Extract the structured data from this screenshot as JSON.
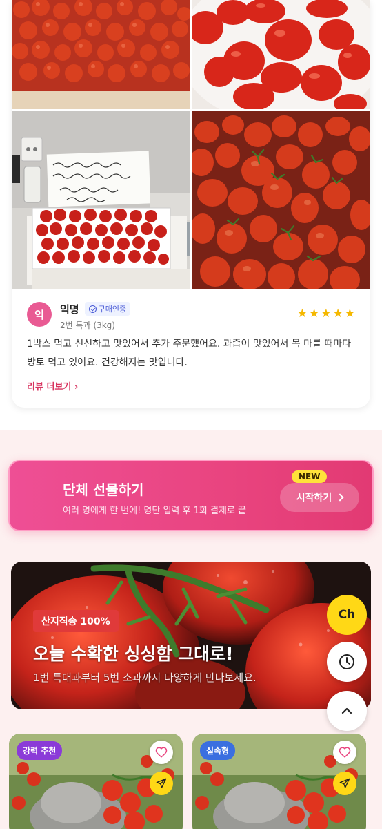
{
  "review": {
    "avatar_initial": "익",
    "name": "익명",
    "verified_label": "구매인증",
    "option": "2번 특과 (3kg)",
    "rating": 5,
    "stars": [
      "★",
      "★",
      "★",
      "★",
      "★"
    ],
    "text": "1박스 먹고 신선하고 맛있어서 추가 주문했어요. 과즙이 맛있어서 목 마를 때마다 방토 먹고 있어요. 건강해지는 맛입니다.",
    "more_link": "리뷰 더보기 ›",
    "note_text": [
      "맛있고 몸에좋은 토마토",
      "출출하실때 간식으로 씻어드세요.",
      "\"바로땡숑\"",
      "사드세요 됩니다~"
    ]
  },
  "group_gift": {
    "title": "단체 선물하기",
    "subtitle": "여러 명에게 한 번에! 명단 입력 후 1회 결제로 끝",
    "badge": "NEW",
    "button_label": "시작하기"
  },
  "hero": {
    "tag": "산지직송 100%",
    "title": "오늘 수확한 싱싱함 그대로!",
    "subtitle": "1번 특대과부터 5번 소과까지 다양하게 만나보세요."
  },
  "floating": {
    "chat_label": "Ch"
  },
  "products": [
    {
      "tag": "강력 추천"
    },
    {
      "tag": "실속형"
    }
  ],
  "colors": {
    "accent_pink": "#e9447f",
    "star": "#f5b800",
    "chat_yellow": "#ffd816",
    "tag_red": "#e03a3a"
  }
}
